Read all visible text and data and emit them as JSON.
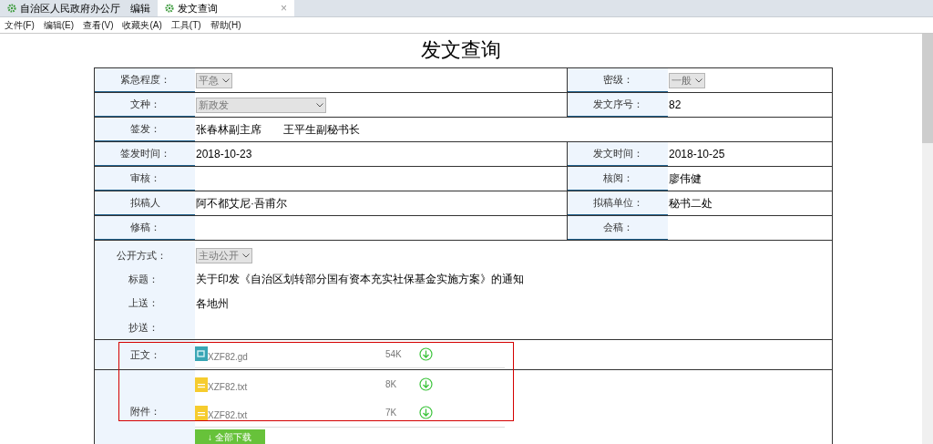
{
  "tabs": [
    {
      "label": "自治区人民政府办公厅　编辑",
      "selected": false
    },
    {
      "label": "发文查询",
      "selected": true,
      "close": "×"
    }
  ],
  "menu": [
    "文件(F)",
    "编辑(E)",
    "查看(V)",
    "收藏夹(A)",
    "工具(T)",
    "帮助(H)"
  ],
  "title": "发文查询",
  "rows": [
    {
      "cells": [
        {
          "label": "紧急程度：",
          "value": "平急",
          "kind": "select"
        },
        {
          "label": "密级：",
          "value": "一般",
          "kind": "select"
        }
      ]
    },
    {
      "cells": [
        {
          "label": "文种：",
          "value": "新政发",
          "kind": "select_wide"
        },
        {
          "label": "发文序号：",
          "value": "82",
          "kind": "text"
        }
      ]
    },
    {
      "cells": [
        {
          "label": "签发：",
          "value": "张春林副主席　　王平生副秘书长",
          "kind": "text"
        }
      ]
    },
    {
      "cells": [
        {
          "label": "签发时间：",
          "value": "2018-10-23",
          "kind": "text"
        },
        {
          "label": "发文时间：",
          "value": "2018-10-25",
          "kind": "text"
        }
      ]
    },
    {
      "cells": [
        {
          "label": "审核："
        },
        {
          "label": "核阅：",
          "value": "廖伟健",
          "kind": "text"
        }
      ]
    },
    {
      "cells": [
        {
          "label": "拟稿人",
          "value": "阿不都艾尼·吾甫尔",
          "kind": "text"
        },
        {
          "label": "拟稿单位：",
          "value": "秘书二处",
          "kind": "text"
        }
      ]
    },
    {
      "cells": [
        {
          "label": "修稿："
        },
        {
          "label": "会稿："
        }
      ]
    }
  ],
  "details": [
    {
      "label": "公开方式：",
      "value": "主动公开",
      "kind": "select"
    },
    {
      "label": "标题：",
      "value": "关于印发《自治区划转部分国有资本充实社保基金实施方案》的通知",
      "kind": "text"
    },
    {
      "label": "上送：",
      "value": "各地州",
      "kind": "text"
    },
    {
      "label": "抄送："
    }
  ],
  "main_text": {
    "label": "正文：",
    "files": [
      {
        "name": "XZF82.gd",
        "size": "54K",
        "kind": "doc"
      }
    ]
  },
  "attachments": {
    "label": "附件：",
    "files": [
      {
        "name": "XZF82.txt",
        "size": "8K",
        "kind": "txt"
      },
      {
        "name": "XZF82.txt",
        "size": "7K",
        "kind": "txt"
      }
    ],
    "download_all": "↓ 全部下载"
  }
}
